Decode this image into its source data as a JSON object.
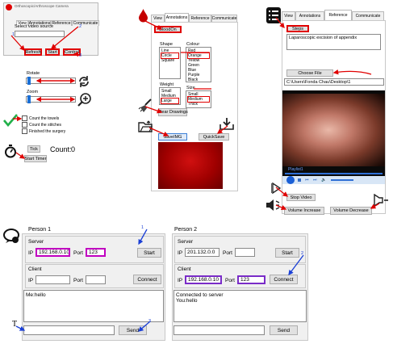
{
  "panel_main": {
    "title": "Orthoscopic/Arthroscope Camera",
    "tabs": [
      "View",
      "Annotations",
      "Reference",
      "Communicate"
    ],
    "select_label": "Select video source",
    "buttons": [
      "Refresh",
      "Start",
      "Control"
    ],
    "numbers": [
      "1",
      "2",
      "3"
    ],
    "rotate_label": "Rotate",
    "zoom_label": "Zoom",
    "checkboxes": [
      "Count the towels",
      "Count the stitches",
      "Finished the surgery"
    ],
    "tick_label": "Tick",
    "count_label": "Count:",
    "count_value": "0",
    "start_timer": "Start Timer"
  },
  "panel_annotations": {
    "tabs": [
      "View",
      "Annotations",
      "Reference",
      "Communicate"
    ],
    "blood_button": "BloodOn",
    "shape_label": "Shape",
    "shapes": [
      "Line",
      "Circle",
      "Square"
    ],
    "colour_label": "Colour",
    "colours": [
      "Red",
      "Orange",
      "Yellow",
      "Green",
      "Blue",
      "Purple",
      "Black"
    ],
    "weight_label": "Weight",
    "weights": [
      "Small",
      "Medium",
      "Large"
    ],
    "size_label": "Size",
    "sizes": [
      "Small",
      "Medium",
      "Thick"
    ],
    "clear_button": "Clear Drawings",
    "save_button": "SaveIMG",
    "quicksave_button": "QuickSave"
  },
  "panel_reference": {
    "tabs": [
      "View",
      "Annotations",
      "Reference",
      "Communicate"
    ],
    "steps_button": "Steps",
    "procedure": "Laparoscopic excision of appendix",
    "choose_file": "Choose File",
    "file_path": "C:\\Users\\Fonda Chau\\Desktop\\1",
    "playlist_label": "Playlist1",
    "stop_video": "Stop Video",
    "volume_increase": "Volume Increase",
    "volume_decrease": "Volume Decrease"
  },
  "person1": {
    "title": "Person 1",
    "server_label": "Server",
    "ip_label": "IP",
    "ip_value": "192.168.0.10",
    "port_label": "Port",
    "port_value": "123",
    "start_button": "Start",
    "client_label": "Client",
    "client_ip_label": "IP",
    "client_port_label": "Port",
    "connect_button": "Connect",
    "chat_log": "Me:hello",
    "send_button": "Send",
    "marks": [
      "1",
      "3"
    ],
    "t_label": "T"
  },
  "person2": {
    "title": "Person 2",
    "server_label": "Server",
    "ip_label": "IP",
    "ip_value": "201.132.0.0",
    "port_label": "Port",
    "start_button": "Start",
    "client_label": "Client",
    "client_ip_label": "IP",
    "client_ip_value": "192.168.0.10",
    "client_port_label": "Port",
    "client_port_value": "123",
    "connect_button": "Connect",
    "chat_log_1": "Connected to server",
    "chat_log_2": "You:hello",
    "send_button": "Send",
    "marks": [
      "2"
    ]
  },
  "colors": {
    "annotation_red": "#e00000",
    "annotation_blue": "#1a3fd6",
    "magenta": "#c000c0",
    "purple": "#7a2cc8"
  }
}
